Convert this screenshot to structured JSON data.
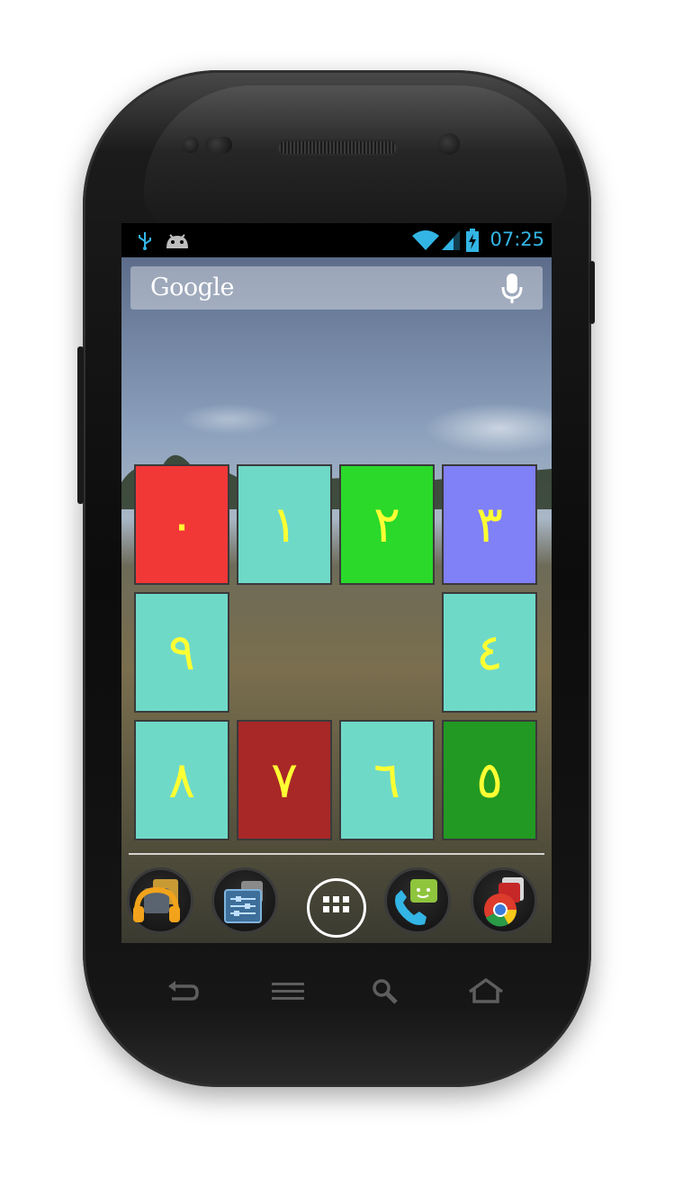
{
  "status_bar": {
    "clock": "07:25",
    "icons": [
      "usb-icon",
      "android-debug-icon",
      "wifi-icon",
      "signal-icon",
      "battery-charging-icon"
    ],
    "accent_color": "#33b5e5"
  },
  "search": {
    "label": "Google",
    "mic_icon": "microphone-icon"
  },
  "widget": {
    "tiles": [
      {
        "label": "٠",
        "color": "#f23737"
      },
      {
        "label": "١",
        "color": "#6fd9c8"
      },
      {
        "label": "٢",
        "color": "#2ad92a"
      },
      {
        "label": "٣",
        "color": "#8080f7"
      },
      {
        "label": "٤",
        "color": "#6fd9c8"
      },
      {
        "label": "٥",
        "color": "#229922"
      },
      {
        "label": "٦",
        "color": "#6fd9c8"
      },
      {
        "label": "٧",
        "color": "#a82828"
      },
      {
        "label": "٨",
        "color": "#6fd9c8"
      },
      {
        "label": "٩",
        "color": "#6fd9c8"
      }
    ],
    "digit_color": "#ffff33"
  },
  "dock": {
    "items": [
      "music-folder-icon",
      "settings-folder-icon",
      "app-drawer-icon",
      "phone-messaging-folder-icon",
      "chrome-folder-icon"
    ]
  },
  "nav_keys": [
    "back-icon",
    "menu-icon",
    "search-icon",
    "home-icon"
  ]
}
